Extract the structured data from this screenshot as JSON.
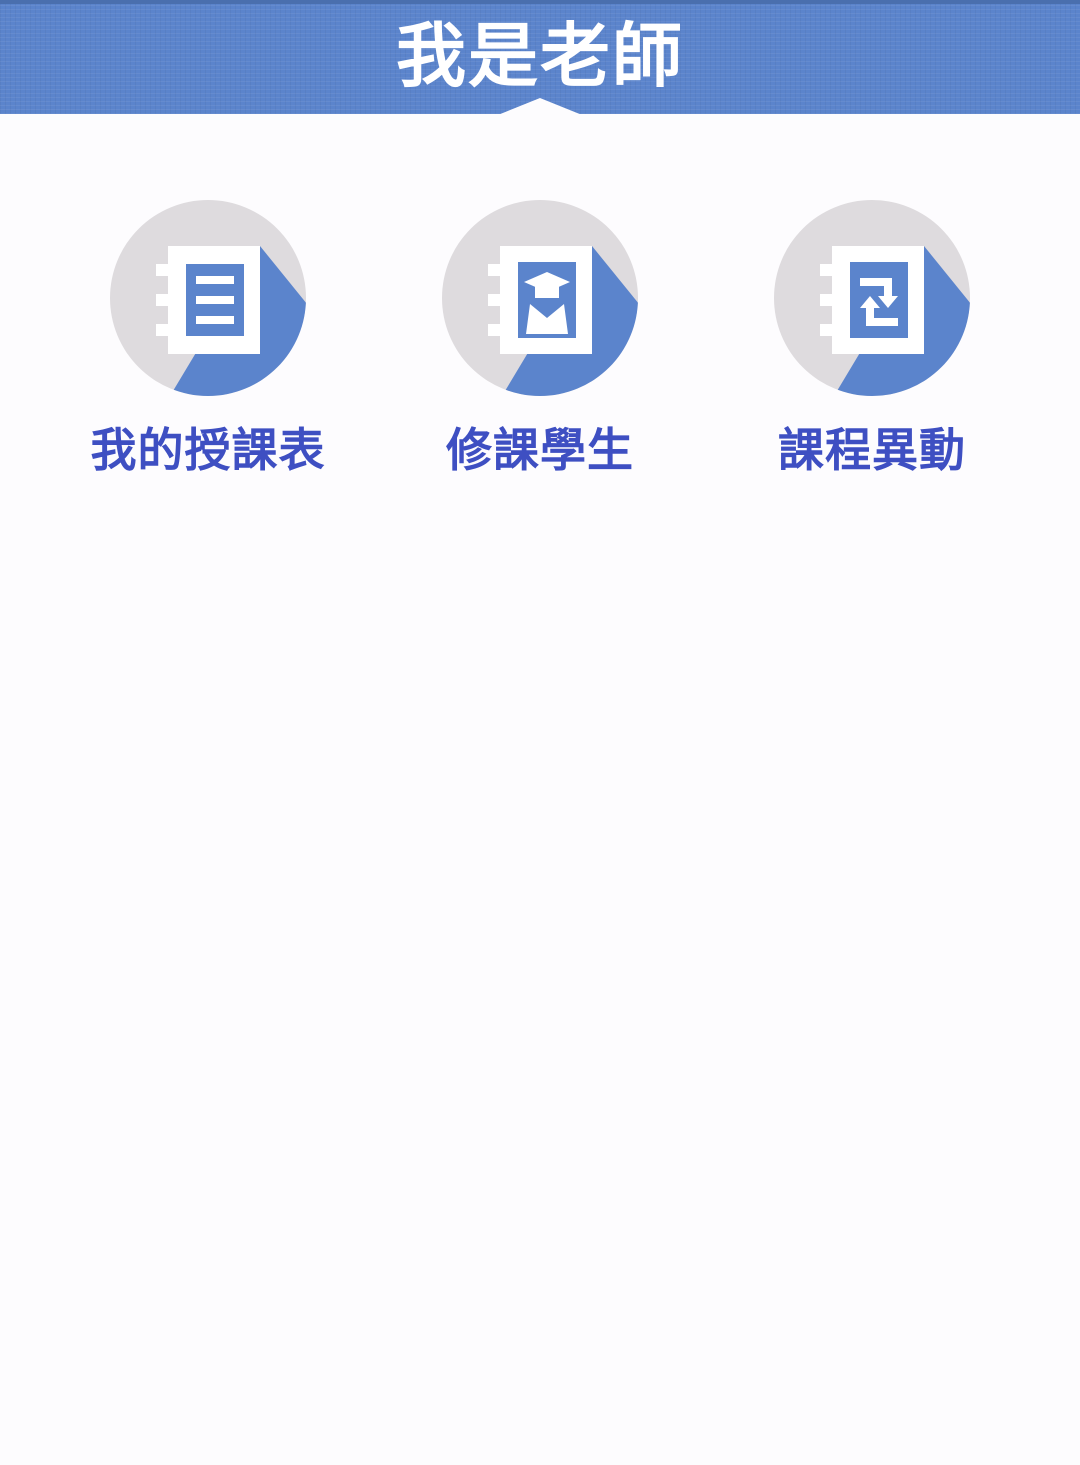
{
  "header": {
    "title": "我是老師"
  },
  "colors": {
    "header_bg": "#5b84cc",
    "accent": "#5b84cc",
    "label": "#3e4fc2",
    "circle": "#dedbde",
    "background": "#fdfcfe"
  },
  "menu": [
    {
      "label": "我的授課表",
      "icon": "timetable-notebook-icon"
    },
    {
      "label": "修課學生",
      "icon": "student-notebook-icon"
    },
    {
      "label": "課程異動",
      "icon": "course-change-notebook-icon"
    }
  ]
}
